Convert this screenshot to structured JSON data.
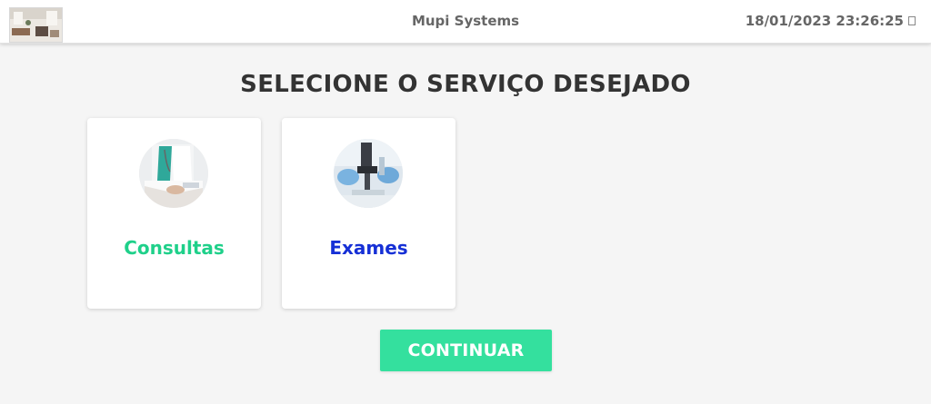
{
  "header": {
    "title": "Mupi Systems",
    "datetime": "18/01/2023 23:26:25",
    "logo_icon": "office-photo-icon",
    "expand_icon": "expand-icon"
  },
  "main": {
    "heading": "SELECIONE O SERVIÇO DESEJADO",
    "services": [
      {
        "label": "Consultas",
        "color": "#1fd08a",
        "icon": "doctor-photo-icon"
      },
      {
        "label": "Exames",
        "color": "#1630d6",
        "icon": "microscope-photo-icon"
      }
    ],
    "continue_label": "CONTINUAR"
  },
  "colors": {
    "accent": "#34e09e",
    "background": "#f5f5f5",
    "card": "#ffffff"
  }
}
